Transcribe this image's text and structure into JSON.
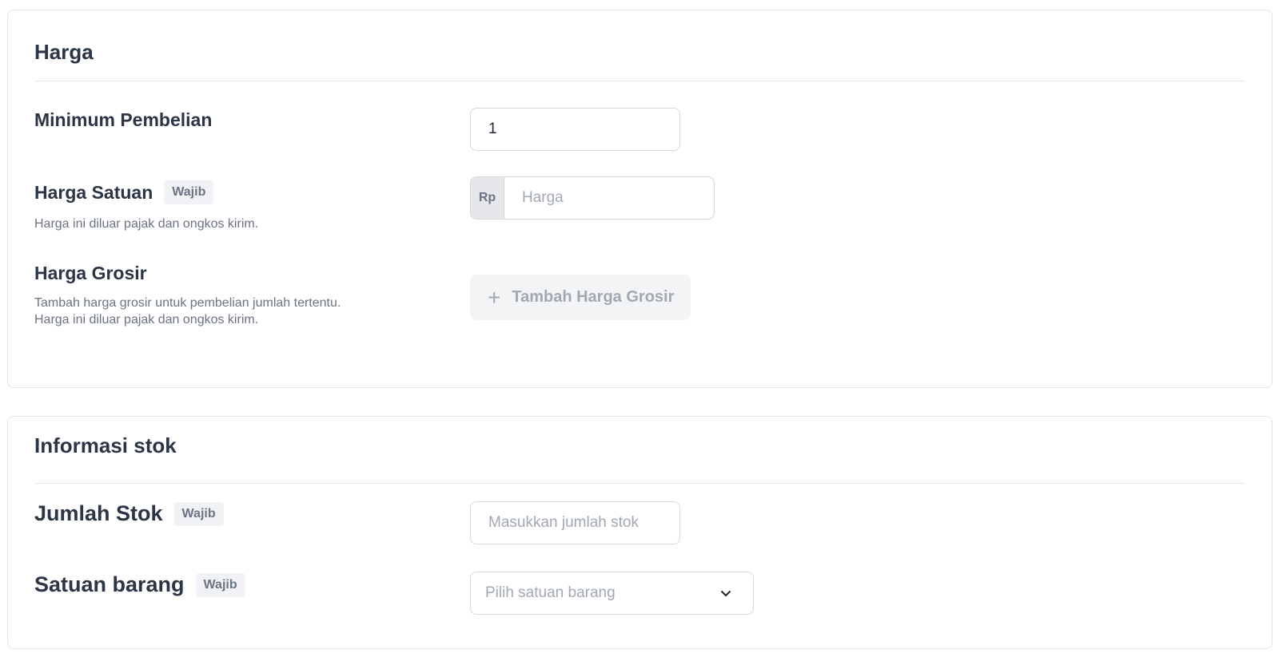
{
  "harga": {
    "title": "Harga",
    "minimum_pembelian": {
      "label": "Minimum Pembelian",
      "value": "1"
    },
    "harga_satuan": {
      "label": "Harga Satuan",
      "badge": "Wajib",
      "help": "Harga ini diluar pajak dan ongkos kirim.",
      "prefix": "Rp",
      "placeholder": "Harga"
    },
    "harga_grosir": {
      "label": "Harga Grosir",
      "help_line1": "Tambah harga grosir untuk pembelian jumlah tertentu.",
      "help_line2": "Harga ini diluar pajak dan ongkos kirim.",
      "button_icon": "plus-icon",
      "button_label": "Tambah Harga Grosir"
    }
  },
  "stok": {
    "title": "Informasi stok",
    "jumlah_stok": {
      "label": "Jumlah Stok",
      "badge": "Wajib",
      "placeholder": "Masukkan jumlah stok"
    },
    "satuan_barang": {
      "label": "Satuan barang",
      "badge": "Wajib",
      "placeholder": "Pilih satuan barang",
      "icon": "chevron-down-icon"
    }
  },
  "colors": {
    "text_primary": "#2b3546",
    "text_muted": "#6b7482",
    "placeholder": "#a3a9b3",
    "border": "#d5d9df",
    "badge_bg": "#f1f2f5",
    "button_disabled_bg": "#f3f4f6"
  }
}
